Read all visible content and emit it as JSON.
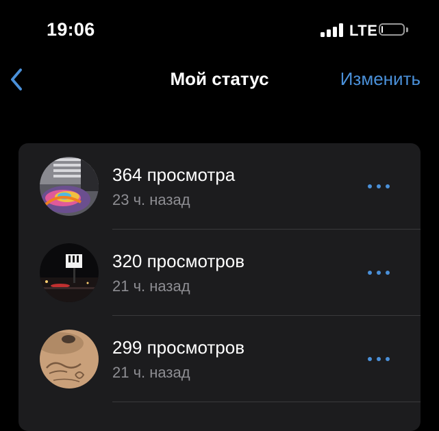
{
  "status_bar": {
    "time": "19:06",
    "network": "LTE",
    "battery_level": 0.05,
    "signal_bars": 4
  },
  "nav": {
    "title": "Мой статус",
    "edit_label": "Изменить",
    "back_icon": "chevron-left-icon"
  },
  "statuses": [
    {
      "views": "364 просмотра",
      "time_ago": "23 ч. назад"
    },
    {
      "views": "320 просмотров",
      "time_ago": "21 ч. назад"
    },
    {
      "views": "299 просмотров",
      "time_ago": "21 ч. назад"
    }
  ],
  "colors": {
    "accent": "#4a90d9",
    "background": "#000000",
    "card": "#1c1c1e",
    "secondary_text": "#8e8e93",
    "divider": "#3a3a3c"
  }
}
